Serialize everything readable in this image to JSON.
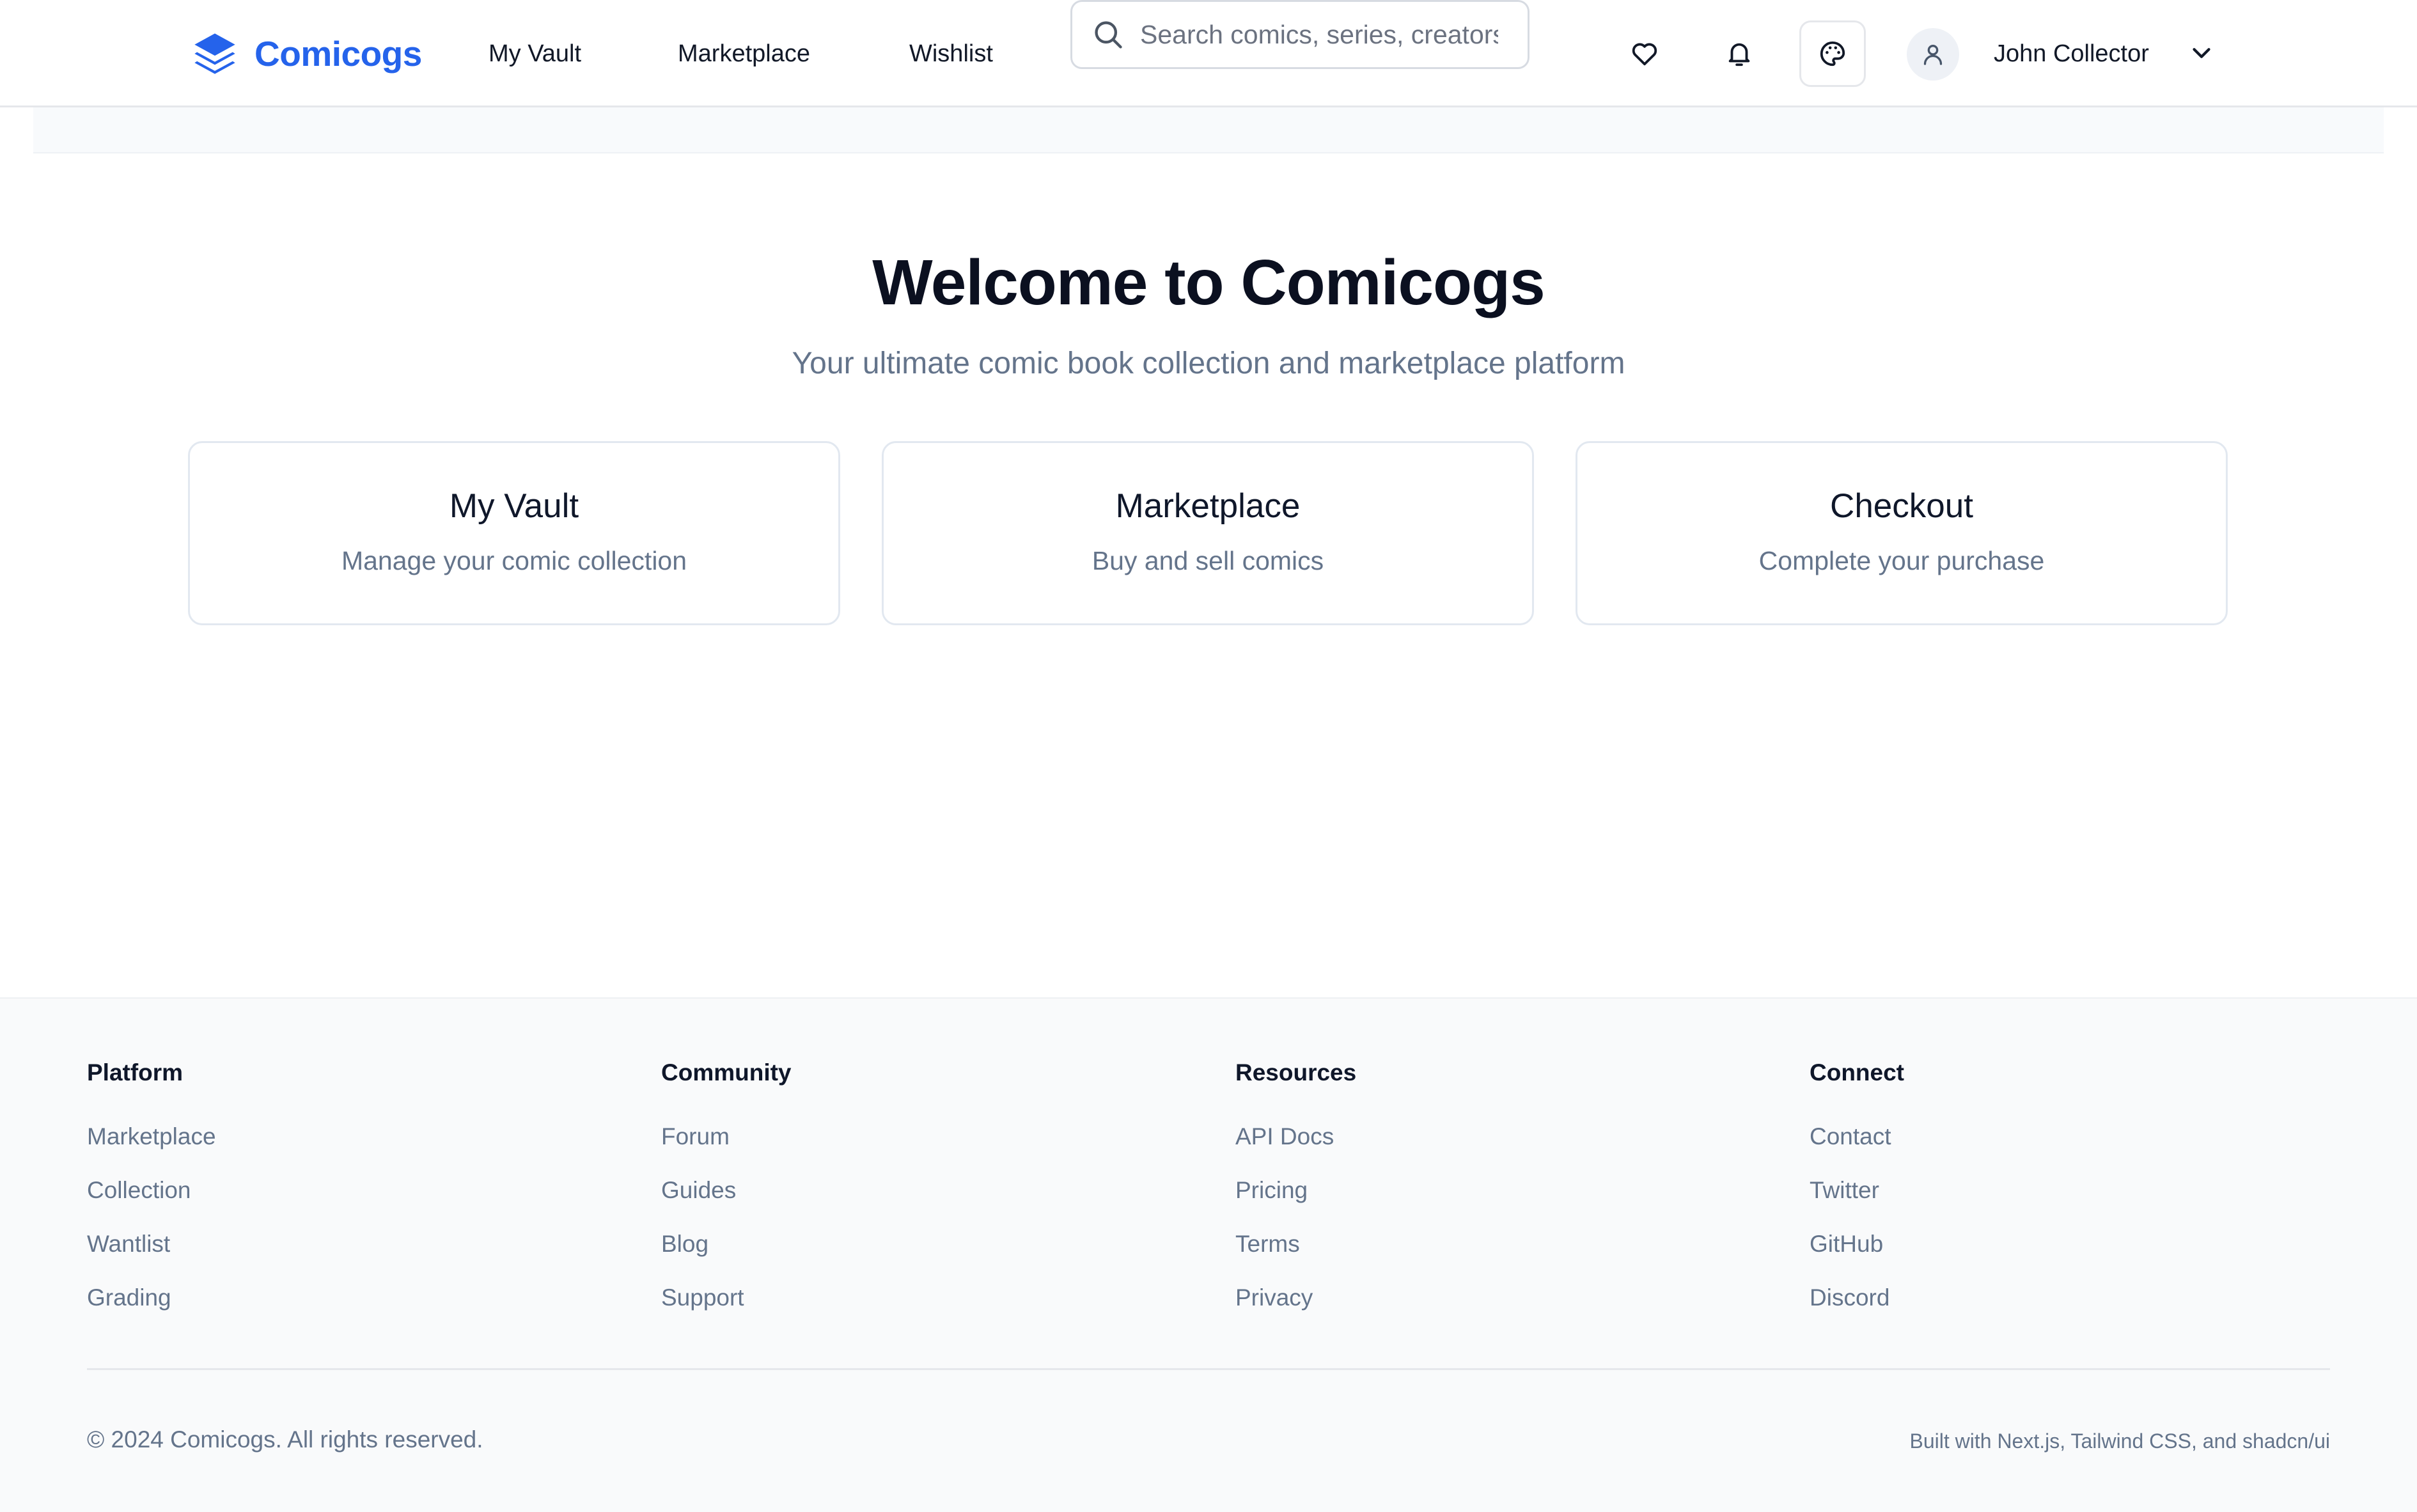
{
  "brand": {
    "name": "Comicogs",
    "accent": "#2563eb"
  },
  "nav": [
    {
      "label": "My Vault"
    },
    {
      "label": "Marketplace"
    },
    {
      "label": "Wishlist"
    }
  ],
  "search": {
    "placeholder": "Search comics, series, creators...",
    "icon": "search-icon"
  },
  "header_actions": {
    "wishlist_icon": "heart-icon",
    "notifications_icon": "bell-icon",
    "theme_icon": "palette-icon"
  },
  "user": {
    "name": "John Collector",
    "avatar_icon": "user-icon",
    "menu_icon": "chevron-down-icon"
  },
  "hero": {
    "title": "Welcome to Comicogs",
    "subtitle": "Your ultimate comic book collection and marketplace platform"
  },
  "cards": [
    {
      "title": "My Vault",
      "description": "Manage your comic collection"
    },
    {
      "title": "Marketplace",
      "description": "Buy and sell comics"
    },
    {
      "title": "Checkout",
      "description": "Complete your purchase"
    }
  ],
  "footer": {
    "columns": [
      {
        "heading": "Platform",
        "links": [
          "Marketplace",
          "Collection",
          "Wantlist",
          "Grading"
        ]
      },
      {
        "heading": "Community",
        "links": [
          "Forum",
          "Guides",
          "Blog",
          "Support"
        ]
      },
      {
        "heading": "Resources",
        "links": [
          "API Docs",
          "Pricing",
          "Terms",
          "Privacy"
        ]
      },
      {
        "heading": "Connect",
        "links": [
          "Contact",
          "Twitter",
          "GitHub",
          "Discord"
        ]
      }
    ],
    "copyright": "© 2024 Comicogs. All rights reserved.",
    "built_with": "Built with Next.js, Tailwind CSS, and shadcn/ui"
  }
}
